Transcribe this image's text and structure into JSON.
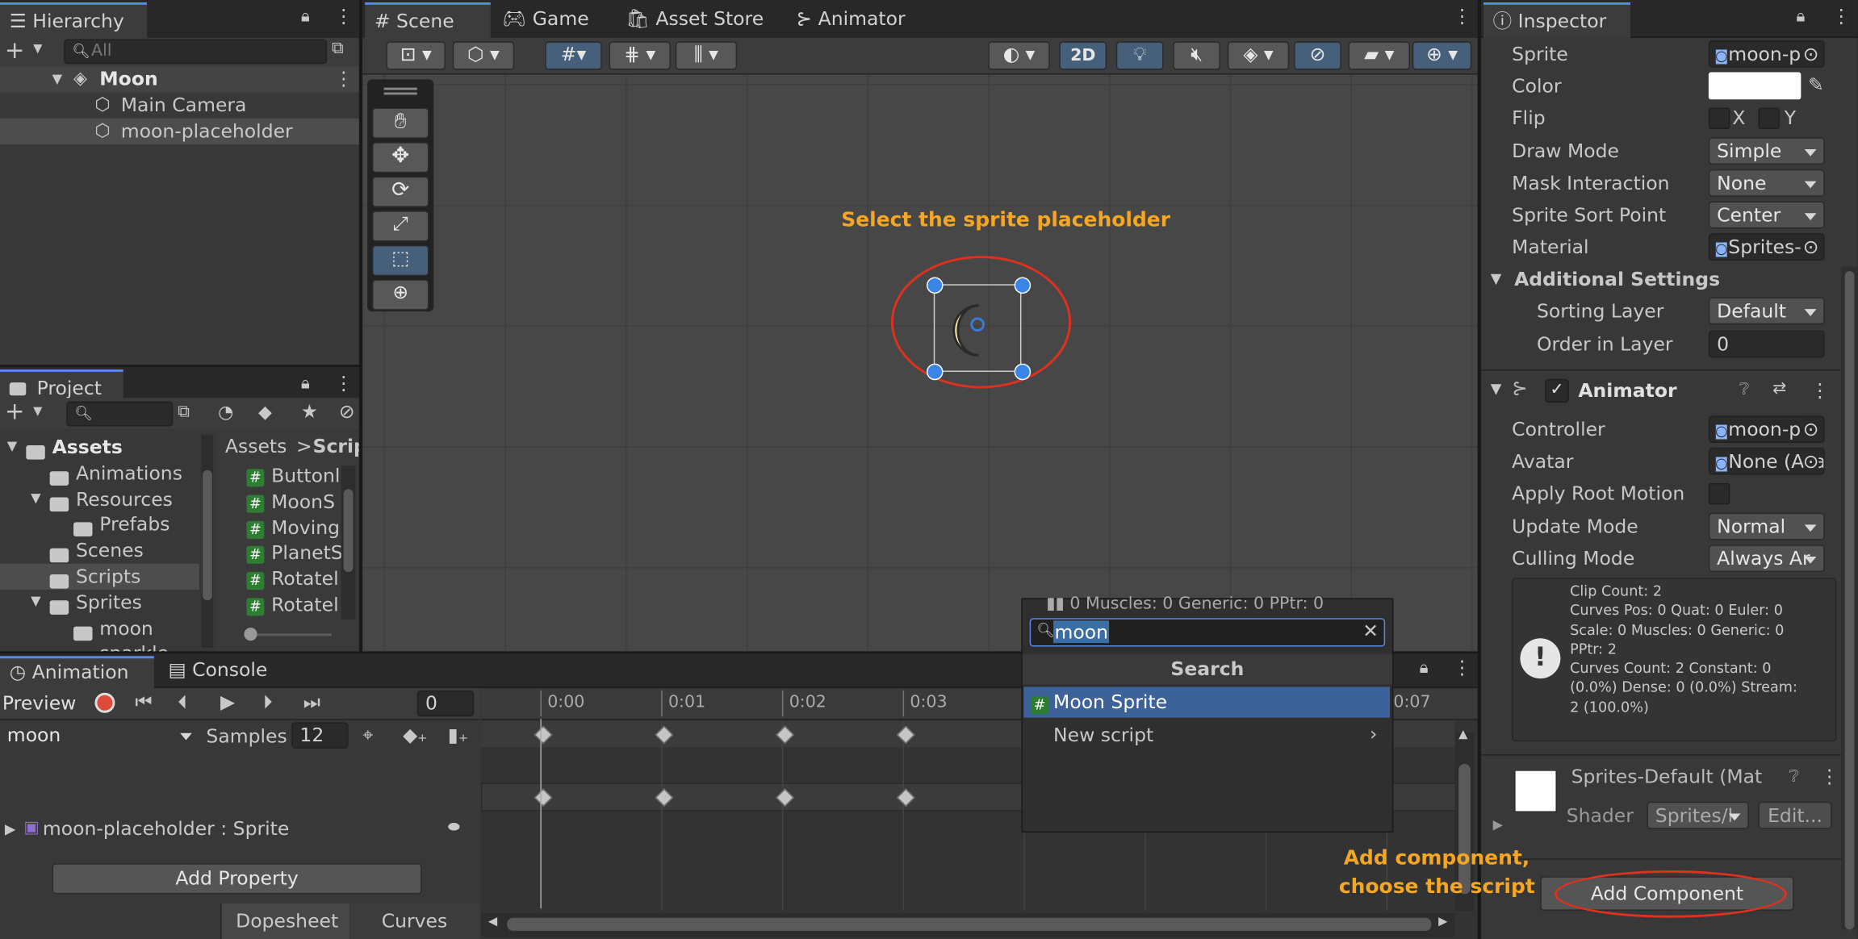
{
  "hierarchy": {
    "tab": "Hierarchy",
    "search_placeholder": "All",
    "scene": "Moon",
    "items": [
      "Main Camera",
      "moon-placeholder"
    ]
  },
  "scene_view": {
    "tabs": [
      "Scene",
      "Game",
      "Asset Store",
      "Animator"
    ],
    "toggle_2d": "2D",
    "annotation": "Select the sprite placeholder"
  },
  "project": {
    "tab": "Project",
    "tree": [
      {
        "label": "Assets",
        "level": 0,
        "bold": true
      },
      {
        "label": "Animations",
        "level": 1
      },
      {
        "label": "Resources",
        "level": 1
      },
      {
        "label": "Prefabs",
        "level": 2
      },
      {
        "label": "Scenes",
        "level": 1
      },
      {
        "label": "Scripts",
        "level": 1,
        "selected": true
      },
      {
        "label": "Sprites",
        "level": 1
      },
      {
        "label": "moon",
        "level": 2
      },
      {
        "label": "sparkle",
        "level": 2
      }
    ],
    "breadcrumb": [
      "Assets",
      "Scrip"
    ],
    "files": [
      "Buttonl",
      "MoonS",
      "Moving",
      "PlanetS",
      "Rotatel",
      "Rotatel"
    ]
  },
  "animation": {
    "tabs": [
      "Animation",
      "Console"
    ],
    "preview": "Preview",
    "frame": "0",
    "clip": "moon",
    "samples_label": "Samples",
    "samples": "12",
    "property": "moon-placeholder : Sprite",
    "add_property": "Add Property",
    "dopesheet": "Dopesheet",
    "curves": "Curves",
    "time_labels": [
      "0:00",
      "0:01",
      "0:02",
      "0:03",
      "0:07"
    ]
  },
  "popup": {
    "search_value": "moon",
    "header": "Search",
    "items": [
      "Moon Sprite",
      "New script"
    ],
    "behind_text": "0 Muscles: 0 Generic: 0 PPtr: 0"
  },
  "inspector": {
    "tab": "Inspector",
    "rows": [
      {
        "label": "Sprite",
        "value": "moon-p",
        "kind": "object"
      },
      {
        "label": "Color",
        "value": "",
        "kind": "color"
      },
      {
        "label": "Flip",
        "value": "",
        "kind": "flip"
      },
      {
        "label": "Draw Mode",
        "value": "Simple",
        "kind": "dropdown"
      },
      {
        "label": "Mask Interaction",
        "value": "None",
        "kind": "dropdown"
      },
      {
        "label": "Sprite Sort Point",
        "value": "Center",
        "kind": "dropdown"
      },
      {
        "label": "Material",
        "value": "Sprites-",
        "kind": "object"
      }
    ],
    "flip_x": "X",
    "flip_y": "Y",
    "additional_settings": "Additional Settings",
    "sorting_layer_label": "Sorting Layer",
    "sorting_layer": "Default",
    "order_label": "Order in Layer",
    "order": "0",
    "animator": {
      "title": "Animator",
      "rows": [
        {
          "label": "Controller",
          "value": "moon-p",
          "kind": "object"
        },
        {
          "label": "Avatar",
          "value": "None (Ava",
          "kind": "object"
        },
        {
          "label": "Apply Root Motion",
          "value": "",
          "kind": "check"
        },
        {
          "label": "Update Mode",
          "value": "Normal",
          "kind": "dropdown"
        },
        {
          "label": "Culling Mode",
          "value": "Always Ar",
          "kind": "dropdown"
        }
      ],
      "info": [
        "Clip Count: 2",
        "Curves Pos: 0 Quat: 0 Euler: 0",
        "Scale: 0 Muscles: 0 Generic: 0",
        "PPtr: 2",
        "Curves Count: 2 Constant: 0",
        "(0.0%) Dense: 0 (0.0%) Stream:",
        "2 (100.0%)"
      ]
    },
    "material": {
      "name": "Sprites-Default (Mat",
      "shader_label": "Shader",
      "shader": "Sprites/l",
      "edit": "Edit..."
    },
    "add_component": "Add Component",
    "annotation_line1": "Add component,",
    "annotation_line2": "choose the script"
  }
}
